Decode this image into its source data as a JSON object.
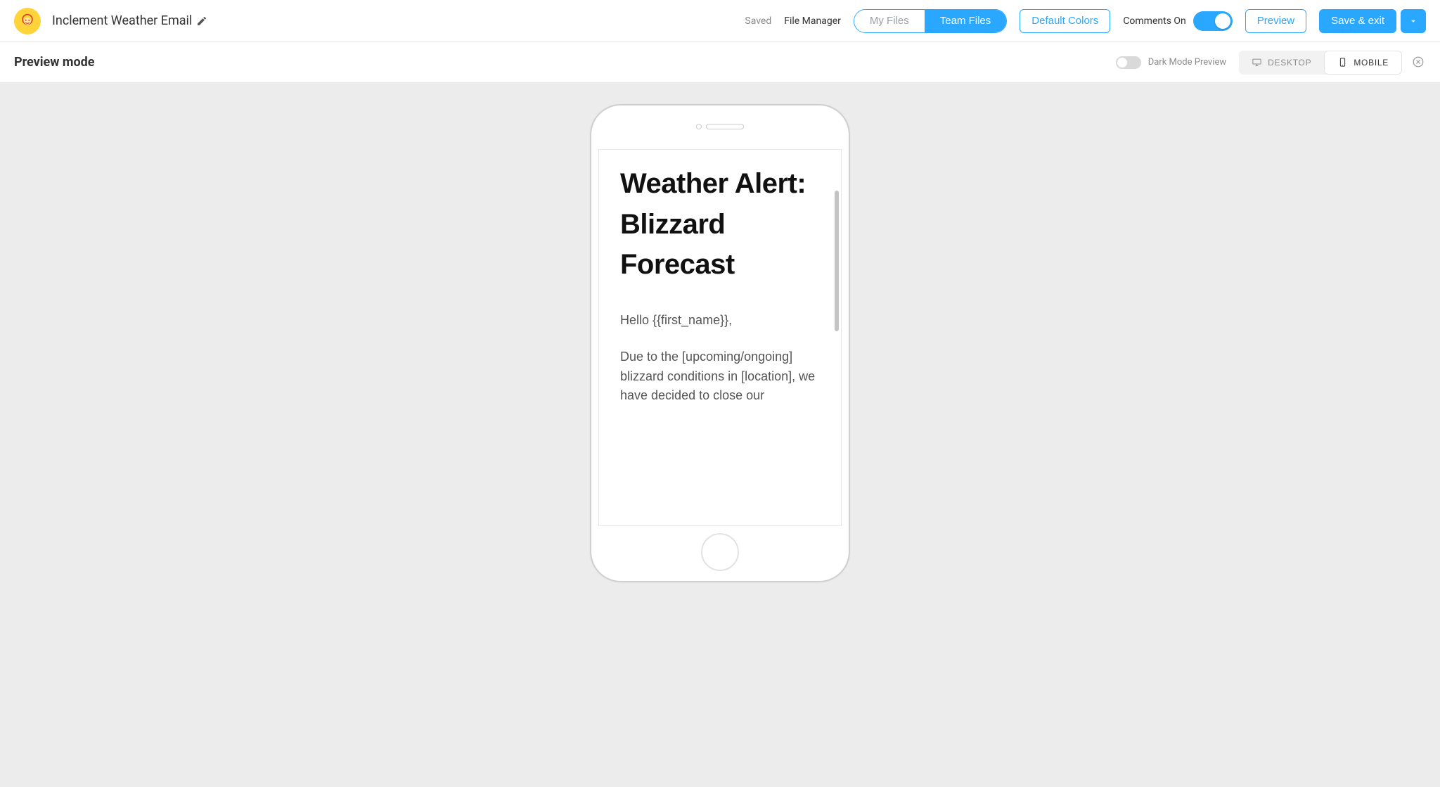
{
  "header": {
    "title": "Inclement Weather Email",
    "saved": "Saved",
    "file_manager": "File Manager",
    "tabs": {
      "my_files": "My Files",
      "team_files": "Team Files"
    },
    "default_colors": "Default Colors",
    "comments_label": "Comments On",
    "preview_btn": "Preview",
    "save_exit_btn": "Save & exit"
  },
  "preview_bar": {
    "mode": "Preview mode",
    "dark_mode_label": "Dark Mode Preview",
    "desktop": "DESKTOP",
    "mobile": "MOBILE"
  },
  "email": {
    "heading": "Weather Alert: Blizzard Forecast",
    "greeting": "Hello {{first_name}},",
    "body": "Due to the [upcoming/ongoing] blizzard conditions in [location], we have decided to close our"
  }
}
